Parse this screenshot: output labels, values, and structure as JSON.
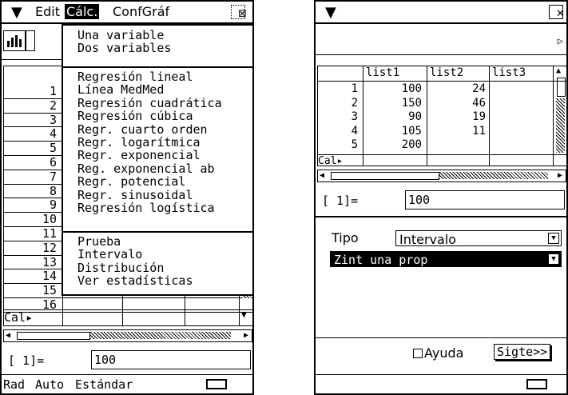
{
  "left_screen": {
    "menubar": {
      "menu_icon": "▼",
      "edit": "Edit",
      "calc": "Cálc.",
      "confgraf": "ConfGráf",
      "close": "⊠"
    },
    "calc_menu": {
      "group1": [
        "Una variable",
        "Dos variables"
      ],
      "group2": [
        "Regresión lineal",
        "Línea MedMed",
        "Regresión cuadrática",
        "Regresión cúbica",
        "Regr. cuarto orden",
        "Regr. logarítmica",
        "Regr. exponencial",
        "Reg. exponencial ab",
        "Regr. potencial",
        "Regr. sinusoidal",
        "Regresión logística"
      ],
      "group3": [
        "Prueba",
        "Intervalo",
        "Distribución",
        "Ver estadísticas"
      ]
    },
    "row_numbers": [
      "1",
      "2",
      "3",
      "4",
      "5",
      "6",
      "7",
      "8",
      "9",
      "10",
      "11",
      "12",
      "13",
      "14",
      "15",
      "16"
    ],
    "cal_label": "Cal▸",
    "entry": {
      "prefix": "[    1]=",
      "value": "100"
    },
    "status": {
      "angle": "Rad",
      "mode": "Auto",
      "format": "Estándar"
    }
  },
  "right_screen": {
    "menubar": {
      "menu_icon": "▼",
      "close": "✕"
    },
    "columns": [
      "list1",
      "list2",
      "list3"
    ],
    "rows": [
      {
        "n": "1",
        "list1": "100",
        "list2": "24"
      },
      {
        "n": "2",
        "list1": "150",
        "list2": "46"
      },
      {
        "n": "3",
        "list1": "90",
        "list2": "19"
      },
      {
        "n": "4",
        "list1": "105",
        "list2": "11"
      },
      {
        "n": "5",
        "list1": "200",
        "list2": ""
      }
    ],
    "cal_label": "Cal▸",
    "entry": {
      "prefix": "[    1]=",
      "value": "100"
    },
    "form": {
      "tipo_label": "Tipo",
      "tipo_value": "Intervalo",
      "test_value": "Zint una prop",
      "ayuda_label": "Ayuda",
      "next_button": "Sigte>>"
    }
  }
}
